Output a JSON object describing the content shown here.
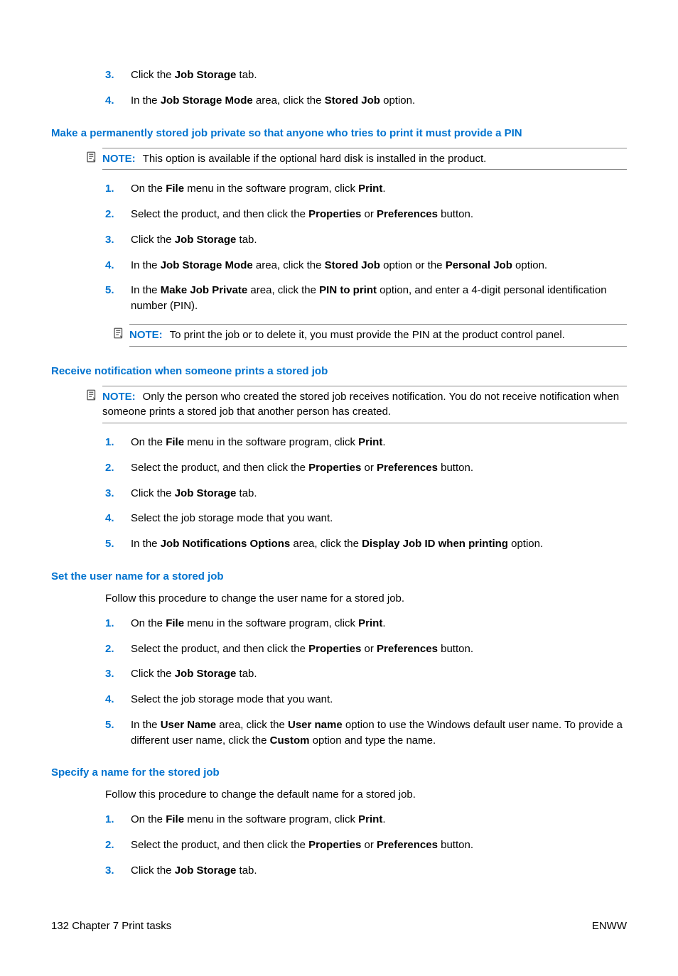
{
  "top_steps": [
    {
      "n": "3.",
      "html": "Click the <b>Job Storage</b> tab."
    },
    {
      "n": "4.",
      "html": "In the <b>Job Storage Mode</b> area, click the <b>Stored Job</b> option."
    }
  ],
  "sec1": {
    "heading": "Make a permanently stored job private so that anyone who tries to print it must provide a PIN",
    "note1": "This option is available if the optional hard disk is installed in the product.",
    "steps": [
      {
        "n": "1.",
        "html": "On the <b>File</b> menu in the software program, click <b>Print</b>."
      },
      {
        "n": "2.",
        "html": "Select the product, and then click the <b>Properties</b> or <b>Preferences</b> button."
      },
      {
        "n": "3.",
        "html": "Click the <b>Job Storage</b> tab."
      },
      {
        "n": "4.",
        "html": "In the <b>Job Storage Mode</b> area, click the <b>Stored Job</b> option or the <b>Personal Job</b> option."
      },
      {
        "n": "5.",
        "html": "In the <b>Make Job Private</b> area, click the <b>PIN to print</b> option, and enter a 4-digit personal identification number (PIN)."
      }
    ],
    "note2": "To print the job or to delete it, you must provide the PIN at the product control panel."
  },
  "sec2": {
    "heading": "Receive notification when someone prints a stored job",
    "note": "Only the person who created the stored job receives notification. You do not receive notification when someone prints a stored job that another person has created.",
    "steps": [
      {
        "n": "1.",
        "html": "On the <b>File</b> menu in the software program, click <b>Print</b>."
      },
      {
        "n": "2.",
        "html": "Select the product, and then click the <b>Properties</b> or <b>Preferences</b> button."
      },
      {
        "n": "3.",
        "html": "Click the <b>Job Storage</b> tab."
      },
      {
        "n": "4.",
        "html": "Select the job storage mode that you want."
      },
      {
        "n": "5.",
        "html": "In the <b>Job Notifications Options</b> area, click the <b>Display Job ID when printing</b> option."
      }
    ]
  },
  "sec3": {
    "heading": "Set the user name for a stored job",
    "intro": "Follow this procedure to change the user name for a stored job.",
    "steps": [
      {
        "n": "1.",
        "html": "On the <b>File</b> menu in the software program, click <b>Print</b>."
      },
      {
        "n": "2.",
        "html": "Select the product, and then click the <b>Properties</b> or <b>Preferences</b> button."
      },
      {
        "n": "3.",
        "html": "Click the <b>Job Storage</b> tab."
      },
      {
        "n": "4.",
        "html": "Select the job storage mode that you want."
      },
      {
        "n": "5.",
        "html": "In the <b>User Name</b> area, click the <b>User name</b> option to use the Windows default user name. To provide a different user name, click the <b>Custom</b> option and type the name."
      }
    ]
  },
  "sec4": {
    "heading": "Specify a name for the stored job",
    "intro": "Follow this procedure to change the default name for a stored job.",
    "steps": [
      {
        "n": "1.",
        "html": "On the <b>File</b> menu in the software program, click <b>Print</b>."
      },
      {
        "n": "2.",
        "html": "Select the product, and then click the <b>Properties</b> or <b>Preferences</b> button."
      },
      {
        "n": "3.",
        "html": "Click the <b>Job Storage</b> tab."
      }
    ]
  },
  "footer": {
    "left": "132   Chapter 7   Print tasks",
    "right": "ENWW"
  },
  "note_label": "NOTE:"
}
